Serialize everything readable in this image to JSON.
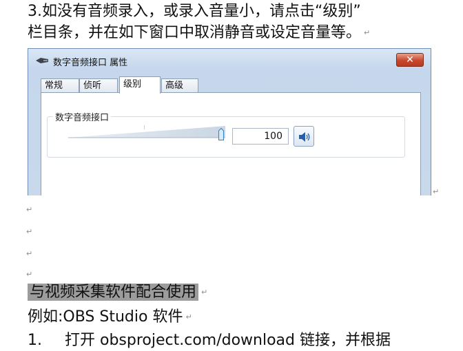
{
  "doc": {
    "line1": "3.如没有音频录入，或录入音量小，请点击“级别”",
    "line2": "栏目条，并在如下窗口中取消静音或设定音量等。",
    "heading": "与视频采集软件配合使用",
    "line_example": "例如:OBS Studio  软件",
    "line_step1_num": "1.",
    "line_step1_text": "打开  obsproject.com/download  链接，并根据",
    "para_mark": "↵"
  },
  "dialog": {
    "title": "数字音频接口 属性",
    "close_label": "✕",
    "tabs": [
      {
        "label": "常规",
        "active": false
      },
      {
        "label": "侦听",
        "active": false
      },
      {
        "label": "级别",
        "active": true
      },
      {
        "label": "高级",
        "active": false
      }
    ],
    "group_label": "数字音频接口",
    "volume_value": "100",
    "volume_level_percent": 100,
    "mute_icon": "speaker-icon"
  }
}
